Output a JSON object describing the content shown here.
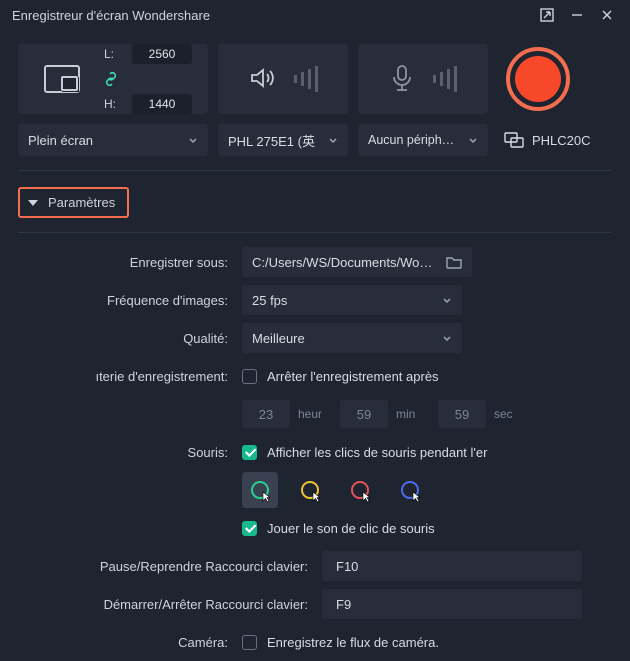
{
  "window": {
    "title": "Enregistreur d'écran Wondershare"
  },
  "capture": {
    "width_label": "L:",
    "width_value": "2560",
    "height_label": "H:",
    "height_value": "1440",
    "mode_selected": "Plein écran",
    "audio_device_selected": "PHL 275E1 (英",
    "mic_device_selected": "Aucun périphérique",
    "remote_display": "PHLC20C"
  },
  "params_header": "Paramètres",
  "settings": {
    "save_to_label": "Enregistrer sous:",
    "save_to_value": "C:/Users/WS/Documents/Wonder",
    "fps_label": "Fréquence d'images:",
    "fps_value": "25 fps",
    "quality_label": "Qualité:",
    "quality_value": "Meilleure",
    "timer_label": "ıterie d'enregistrement:",
    "timer_stop_label": "Arrêter l'enregistrement après",
    "timer_h": "23",
    "timer_h_unit": "heur",
    "timer_m": "59",
    "timer_m_unit": "min",
    "timer_s": "59",
    "timer_s_unit": "sec",
    "mouse_label": "Souris:",
    "mouse_show_clicks_label": "Afficher les clics de souris pendant l'er",
    "mouse_play_sound_label": "Jouer le son de clic de souris",
    "shortcut_pause_label": "Pause/Reprendre Raccourci clavier:",
    "shortcut_pause_value": "F10",
    "shortcut_start_label": "Démarrer/Arrêter Raccourci clavier:",
    "shortcut_start_value": "F9",
    "camera_label": "Caméra:",
    "camera_record_label": "Enregistrez le flux de caméra.",
    "cursor_colors": {
      "c1": "#29d18f",
      "c2": "#f2c233",
      "c3": "#e55353",
      "c4": "#4a6cf0"
    }
  }
}
